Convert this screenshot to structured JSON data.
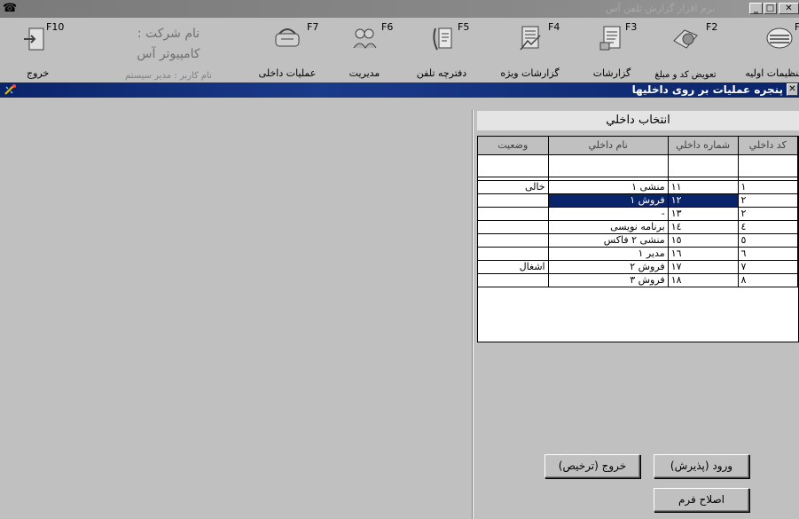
{
  "window": {
    "title": "نرم افزار گزارش تلفن آس"
  },
  "company": {
    "name_line1": "نام شرکت :",
    "name_line2": "کامپیوتر آس",
    "user_line": "نام کاربر : مدیر سیستم"
  },
  "toolbar": [
    {
      "key": "F1",
      "label": "تنظیمات اولیه",
      "icon": "gear-icon"
    },
    {
      "key": "F2",
      "label": "تعویض کد و مبلغ",
      "icon": "exchange-icon"
    },
    {
      "key": "F3",
      "label": "گزارشات",
      "icon": "report-icon"
    },
    {
      "key": "F4",
      "label": "گزارشات ویژه",
      "icon": "special-report-icon"
    },
    {
      "key": "F5",
      "label": "دفترچه تلفن",
      "icon": "phonebook-icon"
    },
    {
      "key": "F6",
      "label": "مدیریت",
      "icon": "management-icon"
    },
    {
      "key": "F7",
      "label": "عملیات داخلی",
      "icon": "internal-ops-icon"
    },
    {
      "key": "F10",
      "label": "خروج",
      "icon": "exit-icon"
    }
  ],
  "subwindow": {
    "title": "پنجره عملیات بر روی داخلیها"
  },
  "panel": {
    "title": "انتخاب داخلي"
  },
  "table": {
    "columns": [
      "کد داخلي",
      "شماره داخلي",
      "نام داخلي",
      "وضعيت"
    ],
    "rows": [
      {
        "code": "۱",
        "number": "۱۱",
        "name": "منشی ۱",
        "status": "خالی"
      },
      {
        "code": "۲",
        "number": "۱۲",
        "name": "فروش ۱",
        "status": ""
      },
      {
        "code": "۲",
        "number": "۱۳",
        "name": "-",
        "status": ""
      },
      {
        "code": "٤",
        "number": "۱٤",
        "name": "برنامه نویسی",
        "status": ""
      },
      {
        "code": "٥",
        "number": "۱٥",
        "name": "منشی ۲ فاکس",
        "status": ""
      },
      {
        "code": "٦",
        "number": "۱٦",
        "name": "مدیر ۱",
        "status": ""
      },
      {
        "code": "۷",
        "number": "۱۷",
        "name": "فروش ۲",
        "status": "اشغال"
      },
      {
        "code": "۸",
        "number": "۱۸",
        "name": "فروش ۳",
        "status": ""
      }
    ],
    "selected_row": 1
  },
  "buttons": {
    "enter": "ورود (پذيرش)",
    "exit": "خروج (ترخيص)",
    "edit": "اصلاح فرم"
  },
  "colors": {
    "selection": "#0a246a",
    "window_bg": "#c0c0c0"
  }
}
